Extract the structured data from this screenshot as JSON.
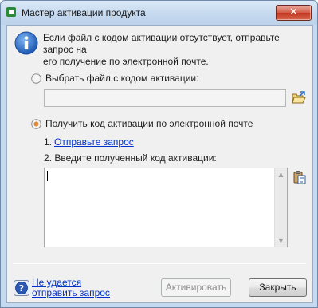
{
  "window": {
    "title": "Мастер активации продукта",
    "close_icon": "close-icon"
  },
  "info": {
    "icon": "info-icon",
    "line1": "Если файл с кодом активации отсутствует, отправьте запрос на",
    "line2": "его получение по электронной почте."
  },
  "option_file": {
    "label": "Выбрать файл с кодом активации:",
    "selected": false,
    "path_value": "",
    "browse_icon": "open-folder-icon"
  },
  "option_email": {
    "label": "Получить код активации по электронной почте",
    "selected": true,
    "step1_prefix": "1.",
    "step1_link": "Отправьте запрос",
    "step2": "2. Введите полученный код активации:",
    "code_value": "",
    "paste_icon": "paste-icon"
  },
  "footer": {
    "help_icon": "help-icon",
    "help_link_line1": "Не удается",
    "help_link_line2": "отправить запрос",
    "activate_label": "Активировать",
    "close_label": "Закрыть"
  }
}
